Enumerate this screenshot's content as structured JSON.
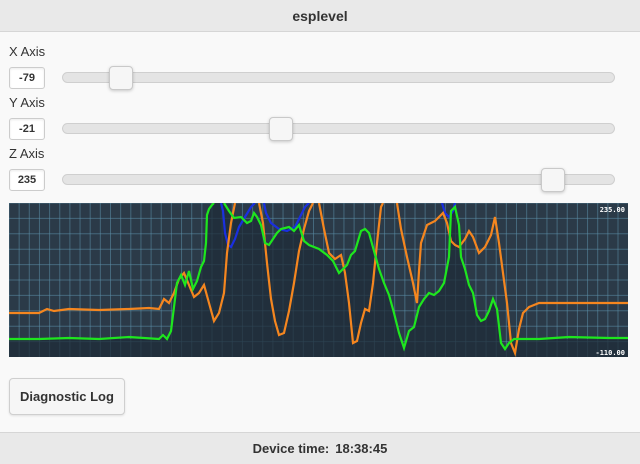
{
  "header": {
    "title": "esplevel"
  },
  "axes": [
    {
      "label": "X Axis",
      "value": "-79",
      "fraction": 0.105
    },
    {
      "label": "Y Axis",
      "value": "-21",
      "fraction": 0.395
    },
    {
      "label": "Z Axis",
      "value": "235",
      "fraction": 0.89
    }
  ],
  "chart": {
    "max_label": "235.00",
    "min_label": "-110.00"
  },
  "diagnostic_button": {
    "label": "Diagnostic Log"
  },
  "footer": {
    "label": "Device time:",
    "time": "18:38:45"
  },
  "colors": {
    "chart_bg": "#2b3a48",
    "grid": "#5c8fa8",
    "x_series": "#f5861f",
    "y_series": "#1a2fe0",
    "z_series": "#1ee61e"
  }
}
